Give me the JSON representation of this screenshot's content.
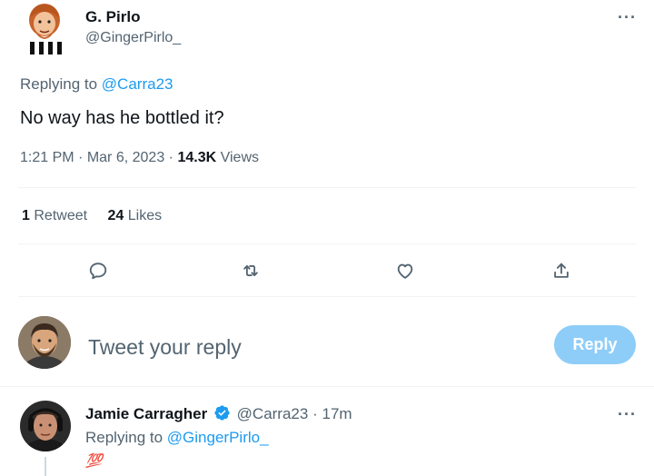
{
  "tweet": {
    "author_name": "G. Pirlo",
    "author_handle": "@GingerPirlo_",
    "replying_label": "Replying to",
    "replying_to": "@Carra23",
    "text": "No way has he bottled it?",
    "time": "1:21 PM",
    "sep1": "·",
    "date": "Mar 6, 2023",
    "sep2": "·",
    "views_count": "14.3K",
    "views_label": "Views",
    "more_icon": "···",
    "stats": {
      "retweets_count": "1",
      "retweets_label": "Retweet",
      "likes_count": "24",
      "likes_label": "Likes"
    },
    "actions": [
      "reply-icon",
      "retweet-icon",
      "like-icon",
      "share-icon"
    ]
  },
  "composer": {
    "placeholder": "Tweet your reply",
    "button_label": "Reply"
  },
  "reply": {
    "author_name": "Jamie Carragher",
    "author_handle": "@Carra23",
    "sep": "·",
    "time": "17m",
    "replying_label": "Replying to",
    "replying_to": "@GingerPirlo_",
    "text": "💯",
    "more_icon": "···",
    "verified_icon": "verified-badge-icon"
  },
  "colors": {
    "accent": "#1d9bf0",
    "muted": "#536471",
    "reply_button": "#8ecdf8",
    "divider": "#eff3f4"
  }
}
